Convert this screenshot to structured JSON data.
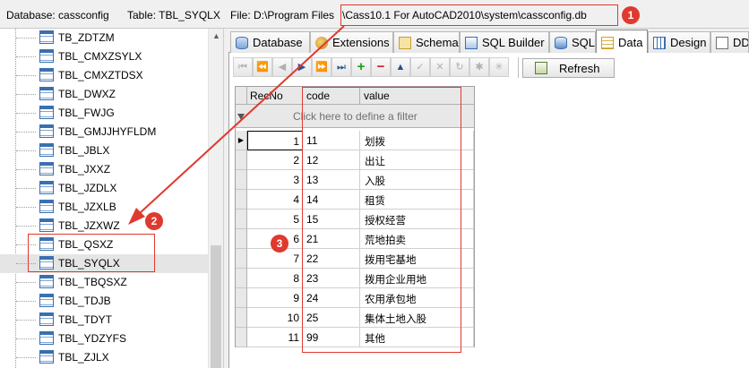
{
  "status": {
    "database_label": "Database: cassconfig",
    "table_label": "Table: TBL_SYQLX",
    "file_prefix": "File: D:\\Program Files",
    "file_path": "\\Cass10.1 For AutoCAD2010\\system\\cassconfig.db"
  },
  "tree": {
    "items": [
      "TB_ZDTZM",
      "TBL_CMXZSYLX",
      "TBL_CMXZTDSX",
      "TBL_DWXZ",
      "TBL_FWJG",
      "TBL_GMJJHYFLDM",
      "TBL_JBLX",
      "TBL_JXXZ",
      "TBL_JZDLX",
      "TBL_JZXLB",
      "TBL_JZXWZ",
      "TBL_QSXZ",
      "TBL_SYQLX",
      "TBL_TBQSXZ",
      "TBL_TDJB",
      "TBL_TDYT",
      "TBL_YDZYFS",
      "TBL_ZJLX"
    ],
    "selected": "TBL_SYQLX"
  },
  "tabs": [
    {
      "label": "Database",
      "icon": "database-icon"
    },
    {
      "label": "Extensions",
      "icon": "extensions-icon"
    },
    {
      "label": "Schema",
      "icon": "schema-icon"
    },
    {
      "label": "SQL Builder",
      "icon": "sql-builder-icon"
    },
    {
      "label": "SQL",
      "icon": "sql-icon"
    },
    {
      "label": "Data",
      "icon": "data-icon",
      "active": true
    },
    {
      "label": "Design",
      "icon": "design-icon"
    },
    {
      "label": "DD",
      "icon": "ddl-icon"
    }
  ],
  "navigator": {
    "buttons": [
      {
        "name": "first-page-button",
        "glyph": "⏮"
      },
      {
        "name": "prior-page-button",
        "glyph": "⏪"
      },
      {
        "name": "prior-record-button",
        "glyph": "◀"
      },
      {
        "name": "next-record-button",
        "glyph": "▶"
      },
      {
        "name": "next-page-button",
        "glyph": "⏩"
      },
      {
        "name": "last-page-button",
        "glyph": "⏭"
      },
      {
        "name": "insert-record-button",
        "glyph": "+"
      },
      {
        "name": "delete-record-button",
        "glyph": "−"
      },
      {
        "name": "edit-record-button",
        "glyph": "▲"
      },
      {
        "name": "post-edit-button",
        "glyph": "✓"
      },
      {
        "name": "cancel-edit-button",
        "glyph": "✕"
      },
      {
        "name": "refresh-record-button",
        "glyph": "↻"
      },
      {
        "name": "set-bookmark-button",
        "glyph": "✱"
      },
      {
        "name": "goto-bookmark-button",
        "glyph": "✳"
      }
    ],
    "refresh_label": "Refresh"
  },
  "grid": {
    "columns": [
      "RecNo",
      "code",
      "value"
    ],
    "filter_placeholder": "Click here to define a filter",
    "rows": [
      {
        "recno": "1",
        "code": "11",
        "value": "划拨"
      },
      {
        "recno": "2",
        "code": "12",
        "value": "出让"
      },
      {
        "recno": "3",
        "code": "13",
        "value": "入股"
      },
      {
        "recno": "4",
        "code": "14",
        "value": "租赁"
      },
      {
        "recno": "5",
        "code": "15",
        "value": "授权经营"
      },
      {
        "recno": "6",
        "code": "21",
        "value": "荒地拍卖"
      },
      {
        "recno": "7",
        "code": "22",
        "value": "拨用宅基地"
      },
      {
        "recno": "8",
        "code": "23",
        "value": "拨用企业用地"
      },
      {
        "recno": "9",
        "code": "24",
        "value": "农用承包地"
      },
      {
        "recno": "10",
        "code": "25",
        "value": "集体土地入股"
      },
      {
        "recno": "11",
        "code": "99",
        "value": "其他"
      }
    ],
    "current_row_marker": "▶"
  },
  "annotations": [
    "1",
    "2",
    "3"
  ],
  "colors": {
    "annotation_red": "#e0392e",
    "selection_gray": "#e5e5e5",
    "link_blue": "#3a6fb0"
  }
}
